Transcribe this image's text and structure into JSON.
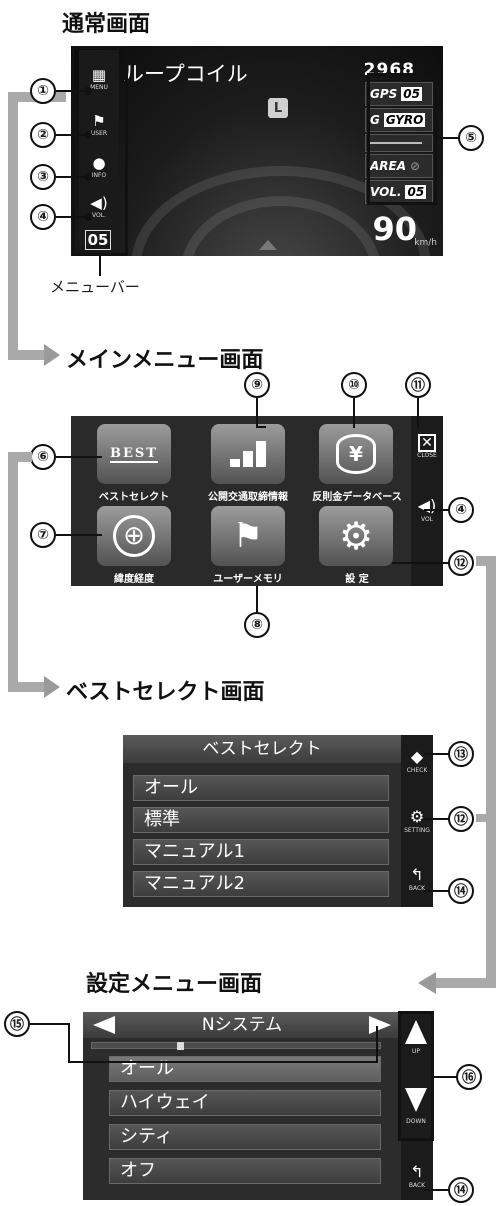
{
  "sections": {
    "normal": "通常画面",
    "main_menu": "メインメニュー画面",
    "best_select": "ベストセレクト画面",
    "settings": "設定メニュー画面"
  },
  "menubar_label": "メニューバー",
  "callouts": [
    "①",
    "②",
    "③",
    "④",
    "⑤",
    "⑥",
    "⑦",
    "⑧",
    "⑨",
    "⑩",
    "⑪",
    "⑫",
    "⑬",
    "⑭",
    "⑮",
    "⑯"
  ],
  "normal_screen": {
    "title": "ループコイル",
    "distance": "2968",
    "lane_marker": "L",
    "speed": "90",
    "speed_unit": "km/h",
    "menubar": [
      {
        "label": "MENU",
        "icon": "grid-icon"
      },
      {
        "label": "USER",
        "icon": "flag-icon"
      },
      {
        "label": "INFO",
        "icon": "info-icon"
      },
      {
        "label": "VOL.",
        "icon": "speaker-icon"
      }
    ],
    "volume_value": "05",
    "status": {
      "gps_label": "GPS",
      "gps_value": "05",
      "g_label": "G",
      "gyro_label": "GYRO",
      "area_label": "AREA",
      "vol_label": "VOL.",
      "vol_value": "05"
    }
  },
  "main_menu_screen": {
    "tiles": [
      {
        "label": "ベストセレクト",
        "icon_text": "BEST"
      },
      {
        "label": "公開交通取締情報",
        "icon": "bar-icon"
      },
      {
        "label": "反則金データベース",
        "icon_text": "¥"
      },
      {
        "label": "緯度経度",
        "icon": "globe-icon"
      },
      {
        "label": "ユーザーメモリ",
        "icon": "flag-icon"
      },
      {
        "label": "設 定",
        "icon": "gear-icon"
      }
    ],
    "close_label": "CLOSE",
    "vol_label": "VOL"
  },
  "best_select_screen": {
    "title": "ベストセレクト",
    "items": [
      "オール",
      "標準",
      "マニュアル1",
      "マニュアル2"
    ],
    "check_label": "CHECK",
    "setting_label": "SETTING",
    "back_label": "BACK"
  },
  "settings_screen": {
    "title": "Nシステム",
    "items": [
      "オール",
      "ハイウェイ",
      "シティ",
      "オフ"
    ],
    "up_label": "UP",
    "down_label": "DOWN",
    "back_label": "BACK",
    "scroll_position": 0.3
  }
}
